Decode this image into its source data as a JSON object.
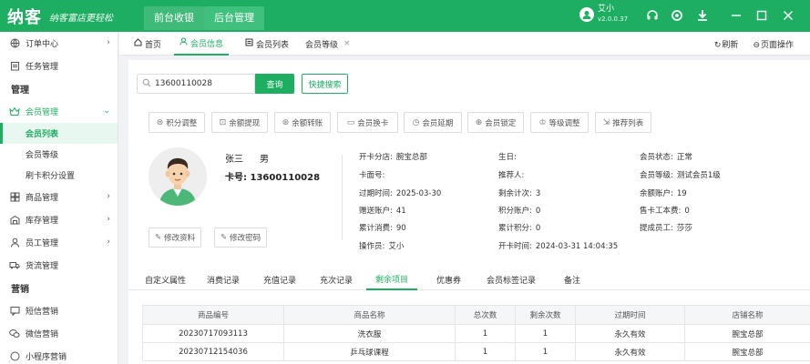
{
  "app": {
    "logo": "纳客",
    "slogan": "纳客富店更轻松",
    "top_tabs": [
      "前台收银",
      "后台管理"
    ],
    "user_name": "艾小",
    "version": "v2.0.0.37"
  },
  "sidebar": {
    "items": [
      {
        "label": "订单中心"
      },
      {
        "label": "任务管理"
      }
    ],
    "section_manage": "管理",
    "member_group": "会员管理",
    "member_subs": [
      "会员列表",
      "会员等级",
      "刷卡积分设置"
    ],
    "items2": [
      {
        "label": "商品管理"
      },
      {
        "label": "库存管理"
      },
      {
        "label": "员工管理"
      },
      {
        "label": "货流管理"
      }
    ],
    "section_marketing": "营销",
    "marketing_items": [
      {
        "label": "短信营销"
      },
      {
        "label": "微信营销"
      },
      {
        "label": "小程序营销"
      }
    ]
  },
  "tabs": {
    "home": "首页",
    "member_info": "会员信息",
    "member_list": "会员列表",
    "member_level": "会员等级",
    "refresh": "刷新",
    "page_ops": "页面操作"
  },
  "search": {
    "value": "13600110028",
    "query_btn": "查询",
    "quick_btn": "快捷搜索"
  },
  "actions": [
    "积分调整",
    "余额提现",
    "余额转账",
    "会员换卡",
    "会员延期",
    "会员锁定",
    "等级调整",
    "推荐列表"
  ],
  "member": {
    "name": "张三",
    "sex": "男",
    "card_label": "卡号:",
    "card_no": "13600110028",
    "edit_profile": "修改资料",
    "edit_password": "修改密码",
    "info": {
      "branch_label": "开卡分店:",
      "branch": "腕宝总部",
      "cardface_label": "卡面号:",
      "cardface": "",
      "expire_label": "过期时间:",
      "expire": "2025-03-30",
      "gift_label": "赠送账户:",
      "gift": "41",
      "consume_label": "累计消费:",
      "consume": "90",
      "operator_label": "操作员:",
      "operator": "艾小",
      "birthday_label": "生日:",
      "birthday": "",
      "referrer_label": "推荐人:",
      "referrer": "",
      "remain_times_label": "剩余计次:",
      "remain_times": "3",
      "points_label": "积分账户:",
      "points": "0",
      "total_points_label": "累计积分:",
      "total_points": "0",
      "open_time_label": "开卡时间:",
      "open_time": "2024-03-31 14:04:35",
      "status_label": "会员状态:",
      "status": "正常",
      "level_label": "会员等级:",
      "level": "测试会员1级",
      "balance_label": "余额账户:",
      "balance": "19",
      "card_fee_label": "售卡工本费:",
      "card_fee": "0",
      "commission_label": "提成员工:",
      "commission": "莎莎"
    }
  },
  "detail_tabs": [
    "自定义属性",
    "消费记录",
    "充值记录",
    "充次记录",
    "剩余项目",
    "优惠券",
    "会员标签记录",
    "备注"
  ],
  "table": {
    "headers": [
      "商品编号",
      "商品名称",
      "总次数",
      "剩余次数",
      "过期时间",
      "店铺名称"
    ],
    "rows": [
      [
        "20230717093113",
        "洗衣服",
        "1",
        "1",
        "永久有效",
        "腕宝总部"
      ],
      [
        "20230712154036",
        "乒乓球课程",
        "1",
        "1",
        "永久有效",
        "腕宝总部"
      ]
    ]
  },
  "colors": {
    "brand": "#1eae62",
    "active_bg": "#e8f7ef"
  },
  "icons": {
    "search": "search-icon",
    "refresh": "refresh-icon",
    "home": "home-icon"
  }
}
